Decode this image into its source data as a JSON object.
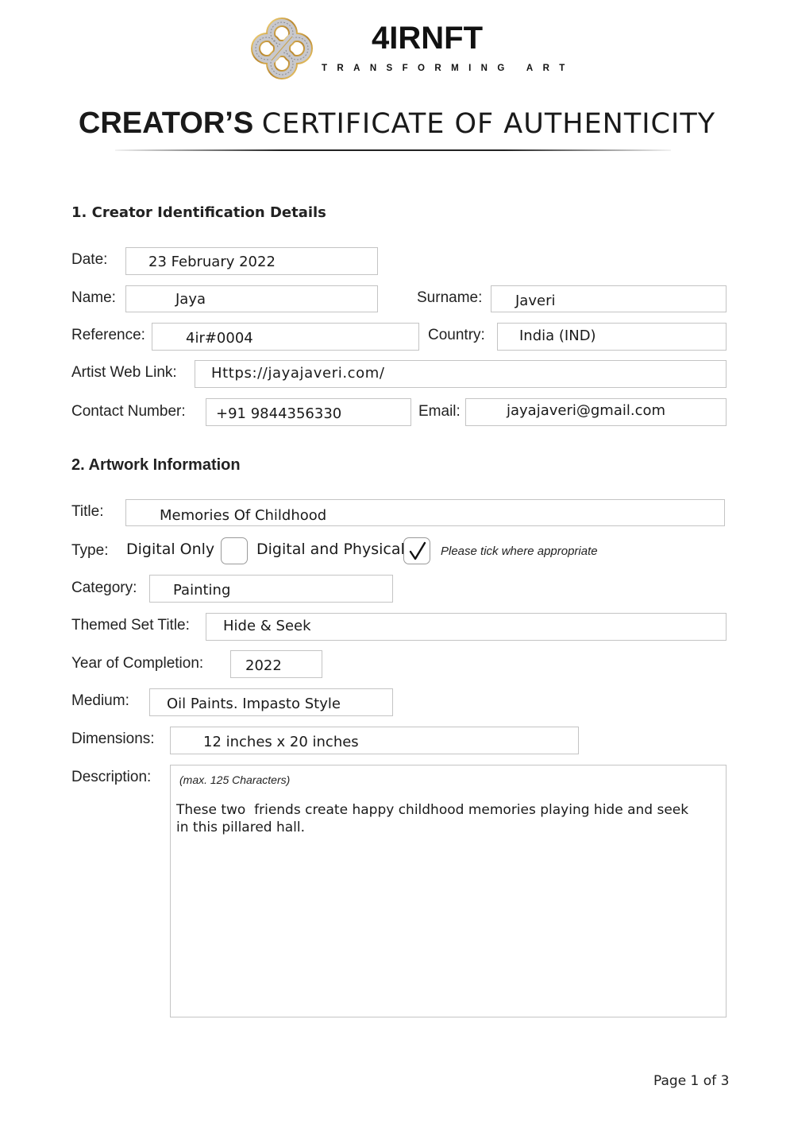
{
  "header": {
    "brand_name": "4IRNFT",
    "brand_tagline": "TRANSFORMING ART",
    "title_bold": "CREATOR’S",
    "title_rest": "CERTIFICATE OF AUTHENTICITY"
  },
  "section1": {
    "heading": "1. Creator Identification Details",
    "fields": {
      "date": {
        "label": "Date:",
        "value": "23 February 2022"
      },
      "name": {
        "label": "Name:",
        "value": "Jaya"
      },
      "surname": {
        "label": "Surname:",
        "value": "Javeri"
      },
      "reference": {
        "label": "Reference:",
        "value": "4ir#0004"
      },
      "country": {
        "label": "Country:",
        "value": "India (IND)"
      },
      "web_link": {
        "label": "Artist Web Link:",
        "value": "Https://jayajaveri.com/"
      },
      "contact_number": {
        "label": "Contact Number:",
        "value": "+91 9844356330"
      },
      "email": {
        "label": "Email:",
        "value": "jayajaveri@gmail.com"
      }
    }
  },
  "section2": {
    "heading": "2. Artwork Information",
    "fields": {
      "title": {
        "label": "Title:",
        "value": "Memories Of Childhood"
      },
      "type": {
        "label": "Type:",
        "options": [
          {
            "label": "Digital Only",
            "checked": false
          },
          {
            "label": "Digital and Physical",
            "checked": true
          }
        ],
        "hint": "Please tick where appropriate"
      },
      "category": {
        "label": "Category:",
        "value": "Painting"
      },
      "themed_set_title": {
        "label": "Themed Set Title:",
        "value": "Hide & Seek"
      },
      "year_of_completion": {
        "label": "Year of Completion:",
        "value": "2022"
      },
      "medium": {
        "label": "Medium:",
        "value": "Oil Paints. Impasto Style"
      },
      "dimensions": {
        "label": "Dimensions:",
        "value": "12 inches x 20 inches"
      },
      "description": {
        "label": "Description:",
        "limit_note": "(max. 125 Characters)",
        "value": "These two  friends create happy childhood memories playing hide and seek in this pillared hall."
      }
    }
  },
  "footer": {
    "page_indicator": "Page 1 of 3"
  },
  "colors": {
    "logo_gold": "#c9a24a",
    "logo_silver": "#c8c8cc",
    "box_border": "#c4c4c4",
    "text": "#1a1a1a"
  }
}
